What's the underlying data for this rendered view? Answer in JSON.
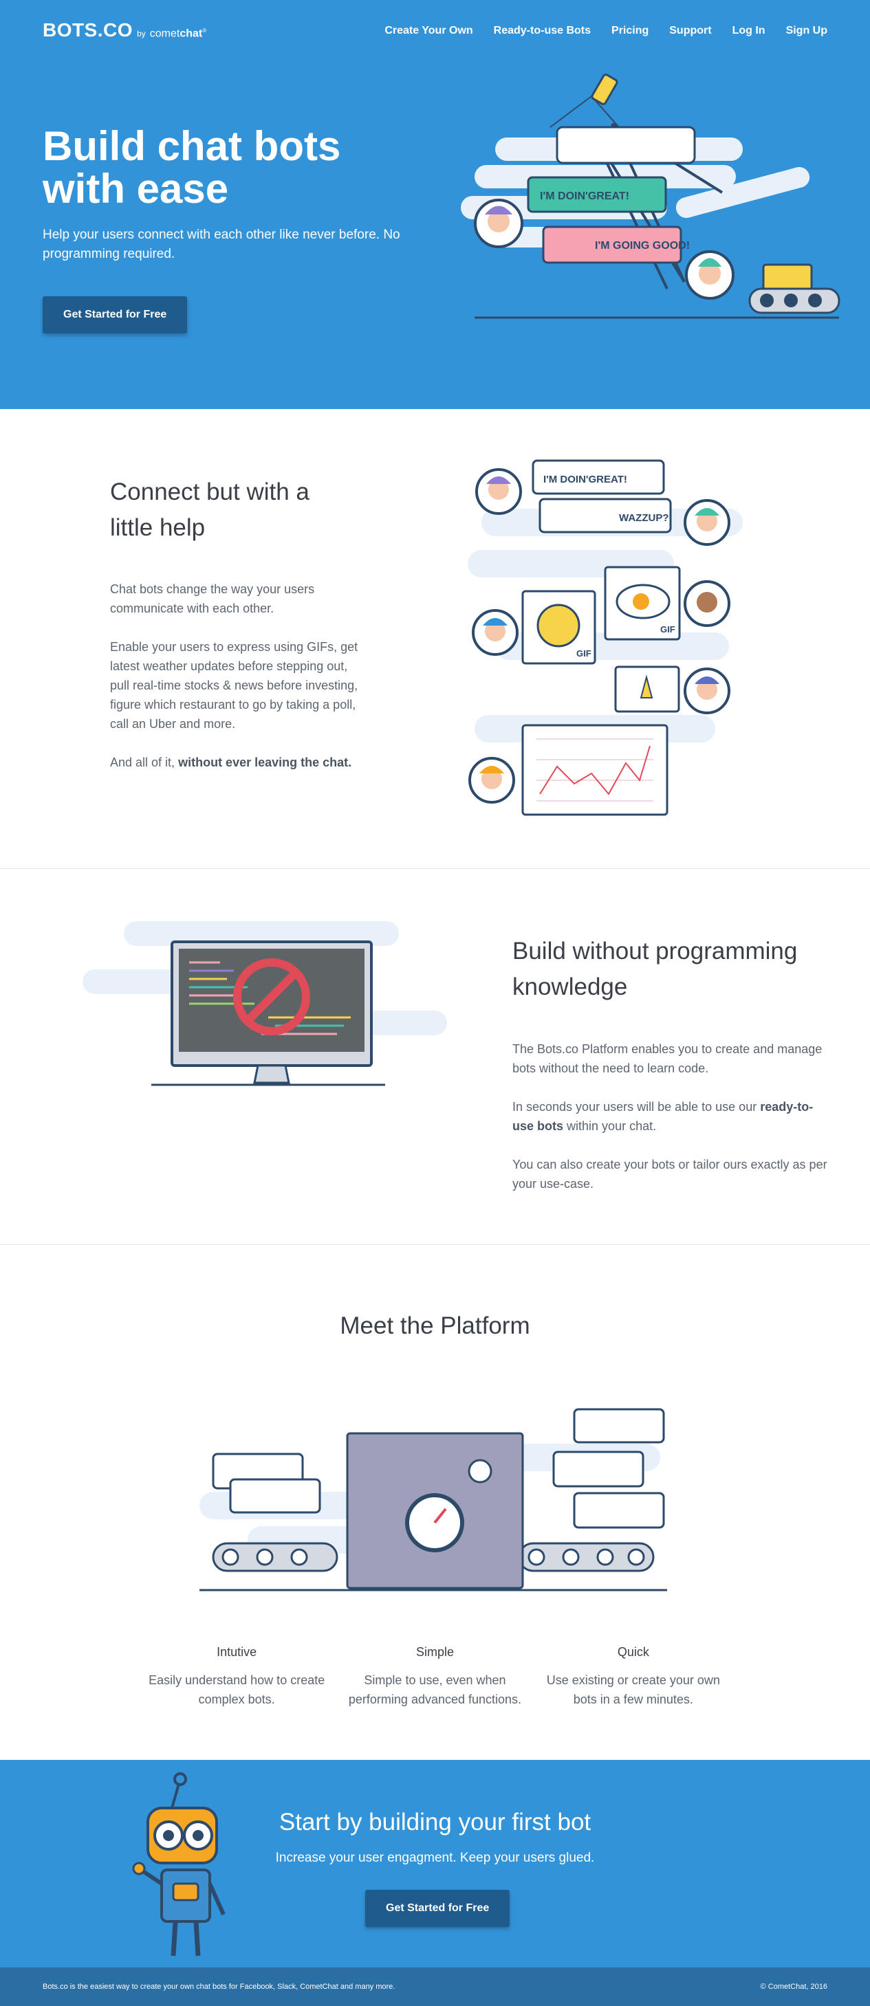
{
  "header": {
    "brand": "BOTS.CO",
    "by": "by",
    "comet_light": "comet",
    "comet_bold": "chat",
    "registered": "®",
    "nav": [
      "Create Your Own",
      "Ready-to-use Bots",
      "Pricing",
      "Support",
      "Log In",
      "Sign Up"
    ]
  },
  "hero": {
    "title": "Build chat bots with ease",
    "subtitle": "Help your users connect with each other like never before. No programming required.",
    "cta": "Get Started for Free",
    "bubble1": "I'M DOIN'GREAT!",
    "bubble2": "I'M GOING GOOD!"
  },
  "section1": {
    "title": "Connect but with a little help",
    "p1": "Chat bots change the way your users communicate with each other.",
    "p2": "Enable your users to express using GIFs, get latest weather updates before stepping out, pull real-time stocks & news before investing, figure which restaurant to go by taking a poll, call an Uber and more.",
    "p3_prefix": "And all of it,",
    "p3_bold": "without ever leaving the chat.",
    "bubble1": "I'M DOIN'GREAT!",
    "bubble2": "WAZZUP?",
    "gif": "GIF"
  },
  "section2": {
    "title": "Build without programming knowledge",
    "p1": "The Bots.co Platform enables you to create and manage bots without the need to learn code.",
    "p2_prefix": "In seconds your users will be able to use our",
    "p2_bold": "ready-to-use bots",
    "p2_suffix": "within your chat.",
    "p3": "You can also create your bots or tailor ours exactly as per your use-case."
  },
  "section3": {
    "title": "Meet the Platform",
    "features": [
      {
        "title": "Intutive",
        "text": "Easily understand how to create complex bots."
      },
      {
        "title": "Simple",
        "text": "Simple to use, even when performing advanced functions."
      },
      {
        "title": "Quick",
        "text": "Use existing or create your own bots in a few minutes."
      }
    ]
  },
  "cta": {
    "title": "Start by building your first bot",
    "subtitle": "Increase your user engagment. Keep your users glued.",
    "button": "Get Started for Free"
  },
  "footer": {
    "left": "Bots.co is the easiest way to create your own chat bots for Facebook, Slack, CometChat and many more.",
    "right": "© CometChat, 2016"
  },
  "colors": {
    "primary": "#3393d8",
    "button": "#1f5b8c",
    "footer": "#2a6ea3",
    "teal_bubble": "#45c1a8",
    "pink_bubble": "#f5a3b2"
  }
}
